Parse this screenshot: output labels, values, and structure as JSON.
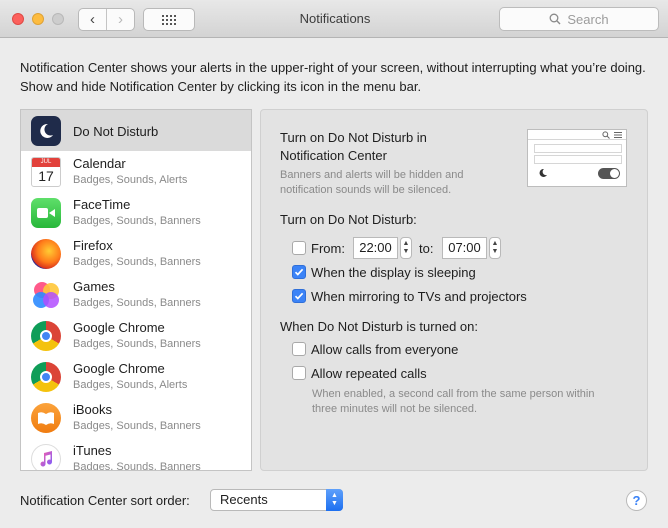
{
  "window": {
    "title": "Notifications",
    "search_placeholder": "Search",
    "back_glyph": "‹",
    "forward_glyph": "›"
  },
  "description": "Notification Center shows your alerts in the upper-right of your screen, without interrupting what you’re doing. Show and hide Notification Center by clicking its icon in the menu bar.",
  "apps": [
    {
      "name": "Do Not Disturb",
      "subtitle": "",
      "icon": "moon-icon",
      "selected": true
    },
    {
      "name": "Calendar",
      "subtitle": "Badges, Sounds, Alerts",
      "icon": "calendar-icon",
      "icon_month": "JUL",
      "icon_day": "17"
    },
    {
      "name": "FaceTime",
      "subtitle": "Badges, Sounds, Banners",
      "icon": "facetime-icon"
    },
    {
      "name": "Firefox",
      "subtitle": "Badges, Sounds, Banners",
      "icon": "firefox-icon"
    },
    {
      "name": "Games",
      "subtitle": "Badges, Sounds, Banners",
      "icon": "games-icon"
    },
    {
      "name": "Google Chrome",
      "subtitle": "Badges, Sounds, Banners",
      "icon": "chrome-icon"
    },
    {
      "name": "Google Chrome",
      "subtitle": "Badges, Sounds, Alerts",
      "icon": "chrome-icon"
    },
    {
      "name": "iBooks",
      "subtitle": "Badges, Sounds, Banners",
      "icon": "ibooks-icon"
    },
    {
      "name": "iTunes",
      "subtitle": "Badges, Sounds, Banners",
      "icon": "itunes-icon"
    }
  ],
  "dnd": {
    "heading_line1": "Turn on Do Not Disturb in",
    "heading_line2": "Notification Center",
    "heading_note_line1": "Banners and alerts will be hidden and",
    "heading_note_line2": "notification sounds will be silenced.",
    "turn_on_label": "Turn on Do Not Disturb:",
    "from_label": "From:",
    "from_checked": false,
    "from_time": "22:00",
    "to_label": "to:",
    "to_time": "07:00",
    "display_sleeping_label": "When the display is sleeping",
    "display_sleeping_checked": true,
    "mirroring_label": "When mirroring to TVs and projectors",
    "mirroring_checked": true,
    "when_on_label": "When Do Not Disturb is turned on:",
    "allow_calls_label": "Allow calls from everyone",
    "allow_calls_checked": false,
    "repeated_calls_label": "Allow repeated calls",
    "repeated_calls_checked": false,
    "repeated_note_line1": "When enabled, a second call from the same person within",
    "repeated_note_line2": "three minutes will not be silenced."
  },
  "bottom": {
    "sort_label": "Notification Center sort order:",
    "sort_value": "Recents",
    "help_glyph": "?"
  },
  "colors": {
    "accent": "#3b83f7",
    "close": "#fc605c",
    "minimize": "#fdbc40"
  }
}
